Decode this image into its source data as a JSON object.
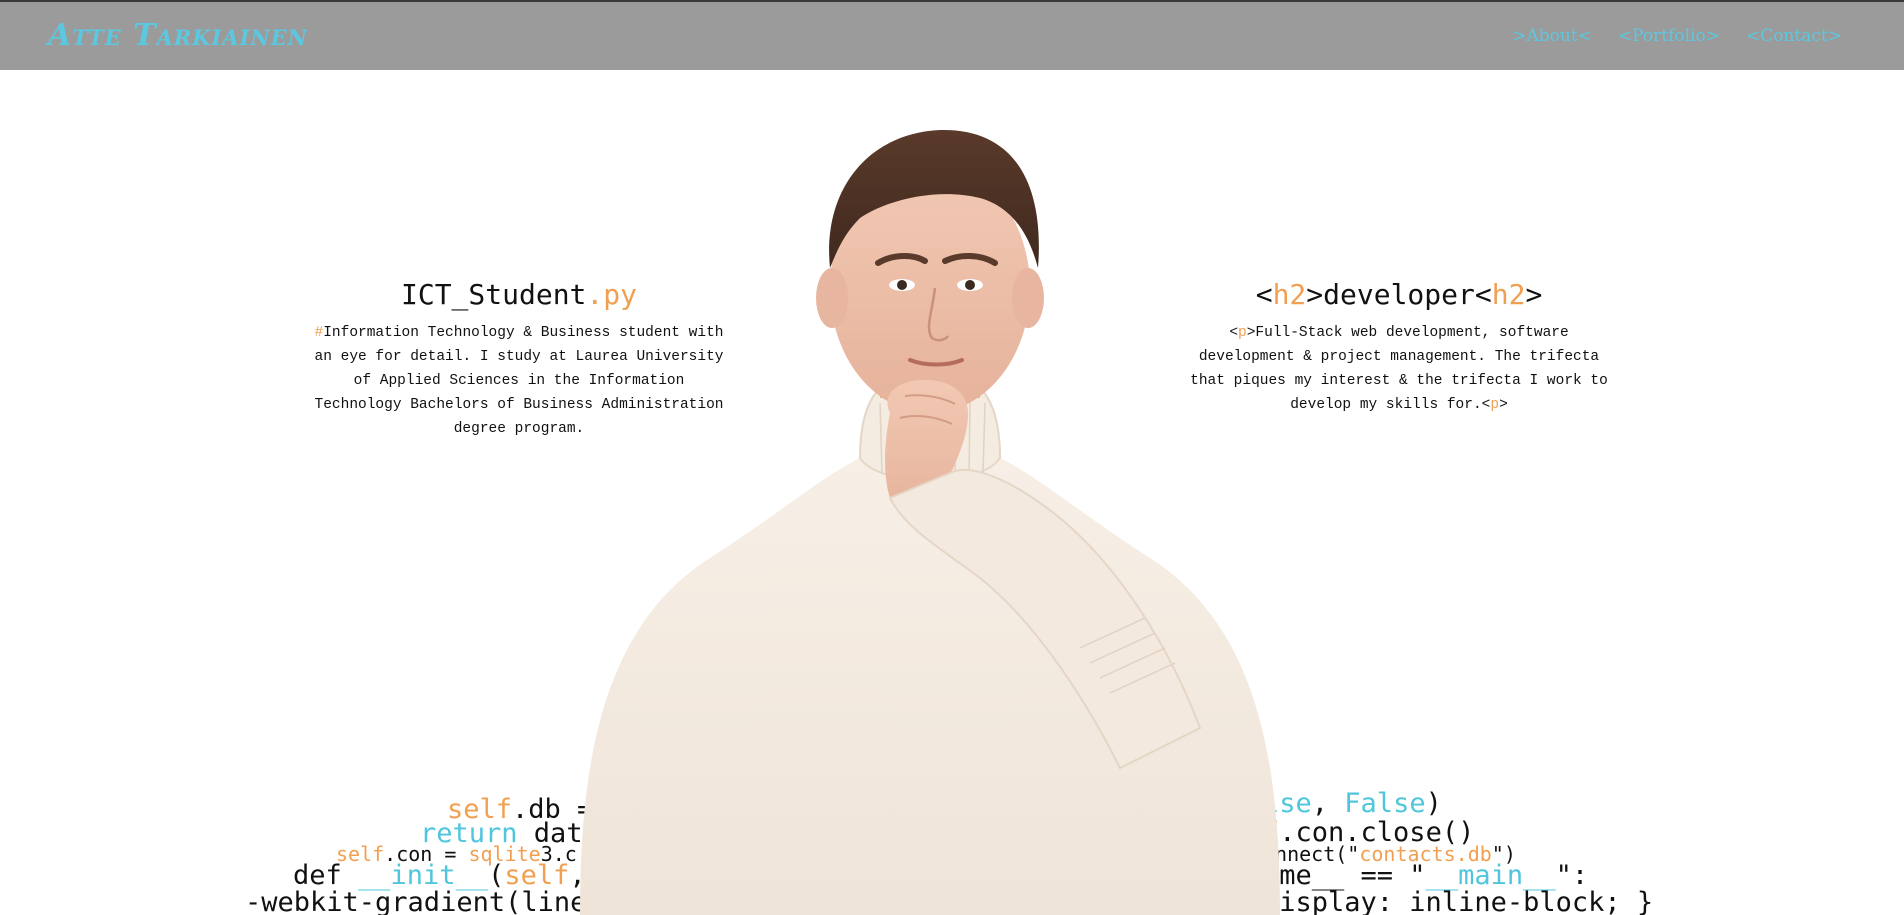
{
  "navbar": {
    "brand": "Atte Tarkiainen",
    "links": [
      ">About<",
      "<Portfolio>",
      "<Contact>"
    ]
  },
  "left_card": {
    "title_main": "ICT_Student",
    "title_ext": ".py",
    "hash": "#",
    "body": "Information Technology & Business student with an eye for detail. I study at Laurea University of Applied Sciences in the Information Technology Bachelors of Business Administration degree program."
  },
  "right_card": {
    "lt1": "<",
    "tag1": "h2",
    "mid": ">developer<",
    "tag2": "h2",
    "gt": ">",
    "open_lt": "<",
    "open_tag": "p",
    "open_gt": ">",
    "body": "Full-Stack web development, software development & project management. The trifecta that piques my interest & the trifecta I work to develop my skills for.",
    "close_lt": "<",
    "close_tag": "p",
    "close_gt": ">"
  },
  "code_background": {
    "left": {
      "l1_kw": "self",
      "l1_rest": ".db = ",
      "l2_kw": "return",
      "l2_rest": " data",
      "l3_kw": "self",
      "l3_mid": ".con = ",
      "l3_mod": "sqlite",
      "l3_rest": "3.c",
      "l4_kw": "def ",
      "l4_fn": "__init__",
      "l4_paren": "(",
      "l4_self": "self",
      "l4_rest": ",",
      "l5": "-webkit-gradient(linea"
    },
    "right": {
      "r1_a": "lse",
      "r1_b": ", ",
      "r1_c": "False",
      "r1_d": ")",
      "r2_a": "f",
      "r2_b": ".con.close()",
      "r3_a": "onnect(\"",
      "r3_b": "contacts.db",
      "r3_c": "\")",
      "r4_a": "ame__ == \"",
      "r4_b": "__main__",
      "r4_c": "\":",
      "r5": "display: inline-block; }"
    }
  },
  "colors": {
    "navbar_bg": "#9b9b9b",
    "brand_accent": "#5bc8e0",
    "orange_accent": "#f0a050",
    "text": "#111111"
  }
}
